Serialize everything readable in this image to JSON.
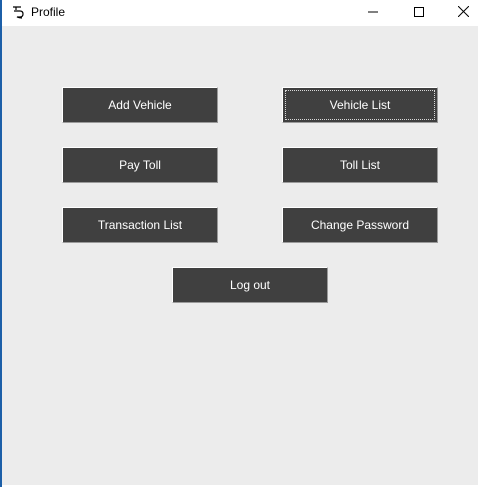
{
  "window": {
    "title": "Profile",
    "icon": "feather-icon"
  },
  "controls": {
    "minimize_icon": "minimize-icon",
    "maximize_icon": "maximize-icon",
    "close_icon": "close-icon"
  },
  "buttons": {
    "add_vehicle": "Add Vehicle",
    "vehicle_list": "Vehicle List",
    "pay_toll": "Pay Toll",
    "toll_list": "Toll List",
    "transaction_list": "Transaction List",
    "change_password": "Change Password",
    "log_out": "Log out"
  },
  "colors": {
    "button_bg": "#404040",
    "client_bg": "#ececec",
    "accent_edge": "#1c5fa8"
  }
}
